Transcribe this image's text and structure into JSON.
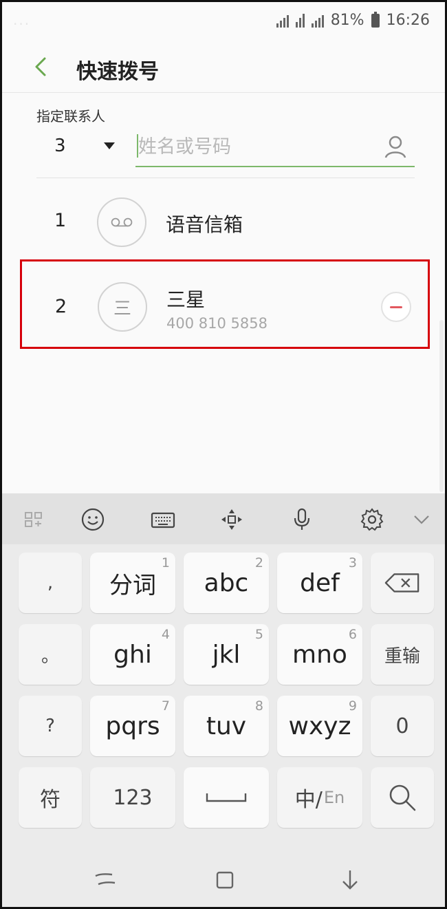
{
  "status_bar": {
    "left_text": "...",
    "battery": "81%",
    "time": "16:26"
  },
  "header": {
    "title": "快速拨号"
  },
  "assign": {
    "label": "指定联系人",
    "selected_number": "3",
    "input_placeholder": "姓名或号码",
    "input_value": ""
  },
  "speed_dial_list": [
    {
      "index": "1",
      "name": "语音信箱",
      "avatar": "voicemail-icon"
    },
    {
      "index": "2",
      "name": "三星",
      "avatar_letter": "三",
      "phone": "400 810 5858"
    }
  ],
  "keyboard": {
    "toolbar": [
      "grid-icon",
      "emoji-icon",
      "keyboard-icon",
      "move-icon",
      "mic-icon",
      "settings-icon",
      "chevron-down-icon"
    ],
    "keys": {
      "comma": ",",
      "fenci": "分词",
      "fenci_digit": "1",
      "abc": "abc",
      "abc_digit": "2",
      "def": "def",
      "def_digit": "3",
      "period": "。",
      "ghi": "ghi",
      "ghi_digit": "4",
      "jkl": "jkl",
      "jkl_digit": "5",
      "mno": "mno",
      "mno_digit": "6",
      "reinput": "重输",
      "question": "?",
      "pqrs": "pqrs",
      "pqrs_digit": "7",
      "tuv": "tuv",
      "tuv_digit": "8",
      "wxyz": "wxyz",
      "wxyz_digit": "9",
      "zero": "0",
      "symbols": "符",
      "numbers": "123",
      "lang_cn": "中/",
      "lang_en": "En"
    }
  },
  "nav_bar": [
    "recent-apps-icon",
    "home-icon",
    "back-down-icon"
  ]
}
